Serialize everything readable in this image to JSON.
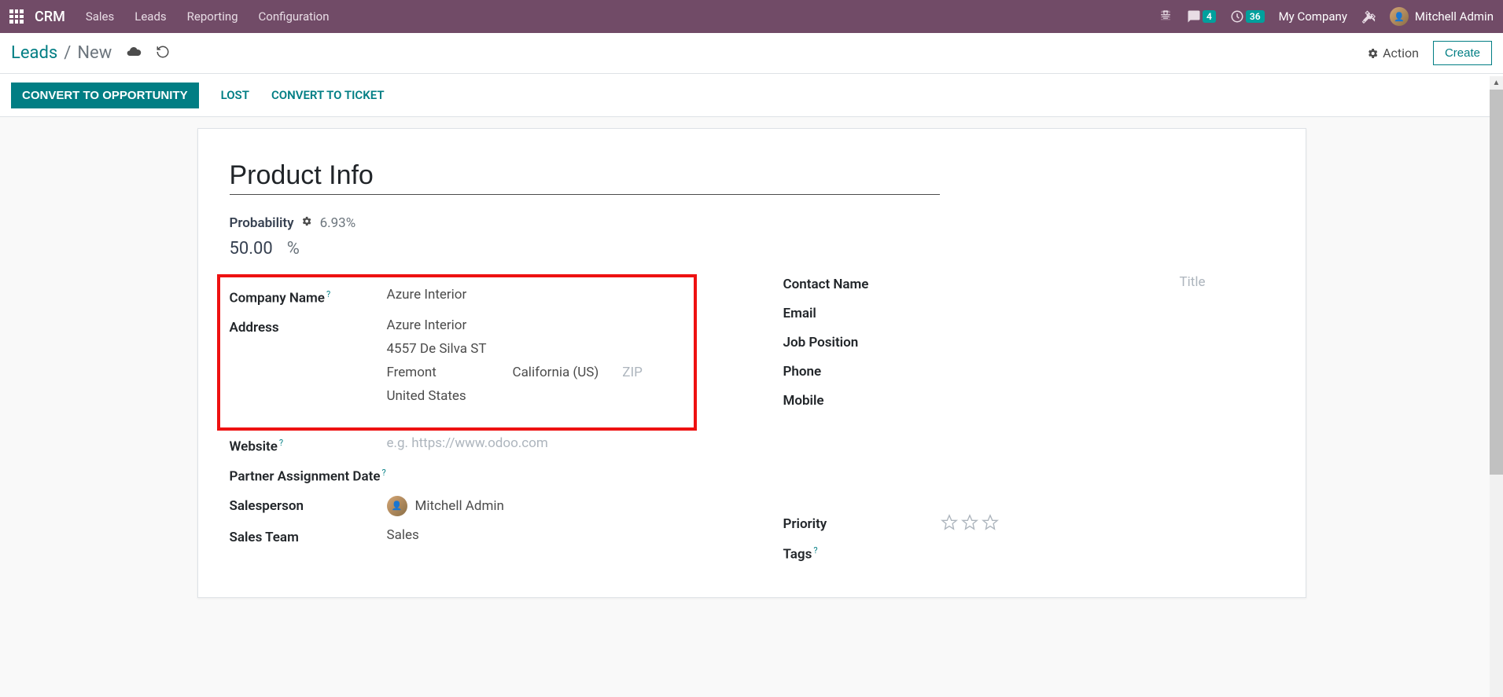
{
  "nav": {
    "brand": "CRM",
    "menu": [
      "Sales",
      "Leads",
      "Reporting",
      "Configuration"
    ],
    "messages_badge": "4",
    "activities_badge": "36",
    "company": "My Company",
    "user": "Mitchell Admin"
  },
  "breadcrumb": {
    "parent": "Leads",
    "current": "New",
    "action_label": "Action",
    "create_label": "Create"
  },
  "status": {
    "convert_opp": "CONVERT TO OPPORTUNITY",
    "lost": "LOST",
    "convert_ticket": "CONVERT TO TICKET"
  },
  "form": {
    "title": "Product Info",
    "probability_label": "Probability",
    "probability_hint": "6.93%",
    "probability_value": "50.00",
    "percent_sign": "%",
    "company_name_label": "Company Name",
    "company_name_value": "Azure Interior",
    "address_label": "Address",
    "address_name": "Azure Interior",
    "address_street": "4557 De Silva ST",
    "address_city": "Fremont",
    "address_state": "California (US)",
    "address_zip_placeholder": "ZIP",
    "address_country": "United States",
    "website_label": "Website",
    "website_placeholder": "e.g. https://www.odoo.com",
    "partner_assign_label": "Partner Assignment Date",
    "salesperson_label": "Salesperson",
    "salesperson_value": "Mitchell Admin",
    "salesteam_label": "Sales Team",
    "salesteam_value": "Sales",
    "contact_name_label": "Contact Name",
    "title_placeholder": "Title",
    "email_label": "Email",
    "job_label": "Job Position",
    "phone_label": "Phone",
    "mobile_label": "Mobile",
    "priority_label": "Priority",
    "tags_label": "Tags"
  }
}
